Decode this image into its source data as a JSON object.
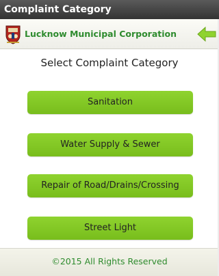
{
  "window": {
    "title": "Complaint Category"
  },
  "header": {
    "logo_icon": "municipal-emblem-icon",
    "org_name": "Lucknow Municipal Corporation",
    "back_icon": "back-arrow-icon",
    "accent_color": "#2e8b2e"
  },
  "main": {
    "heading": "Select Complaint Category",
    "categories": [
      {
        "label": "Sanitation"
      },
      {
        "label": "Water Supply & Sewer"
      },
      {
        "label": "Repair of Road/Drains/Crossing"
      },
      {
        "label": "Street Light"
      }
    ],
    "button_color": "#85c926"
  },
  "footer": {
    "copyright": "©2015 All Rights Reserved"
  }
}
